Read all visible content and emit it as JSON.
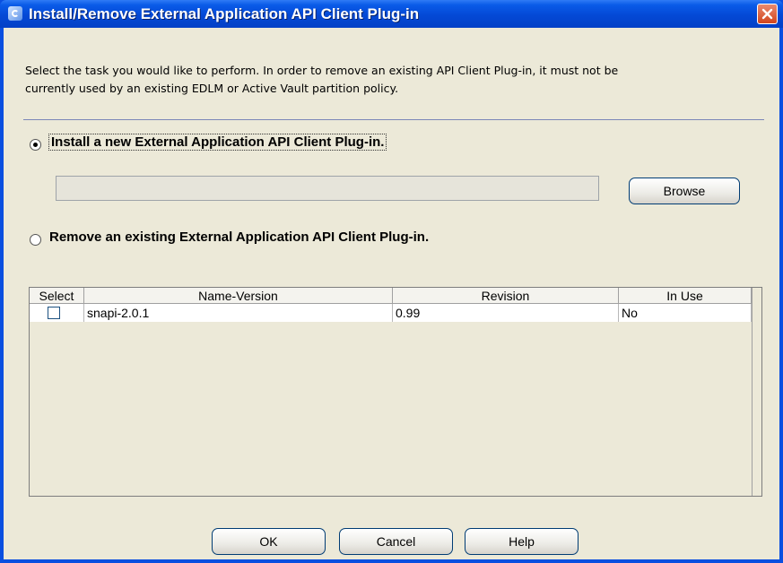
{
  "window": {
    "title": "Install/Remove External Application API Client Plug-in"
  },
  "description": {
    "line1": "Select the task you would like to perform. In order to remove an existing API Client Plug-in, it must not be",
    "line2": "currently used by an existing EDLM or Active Vault partition policy."
  },
  "options": {
    "install": {
      "label": "Install a new External Application API Client Plug-in.",
      "selected": true
    },
    "remove": {
      "label": "Remove an existing External Application API Client Plug-in.",
      "selected": false
    }
  },
  "install_path": {
    "value": ""
  },
  "browse_label": "Browse",
  "table": {
    "columns": [
      "Select",
      "Name-Version",
      "Revision",
      "In Use"
    ],
    "rows": [
      {
        "select": false,
        "name_version": "snapi-2.0.1",
        "revision": "0.99",
        "in_use": "No"
      }
    ]
  },
  "buttons": {
    "ok": "OK",
    "cancel": "Cancel",
    "help": "Help"
  },
  "colors": {
    "titlebar": "#0449d6",
    "dialog_bg": "#ece9d8",
    "close_button": "#d1451d"
  },
  "icons": {
    "app": "app-icon",
    "close": "close-icon"
  }
}
